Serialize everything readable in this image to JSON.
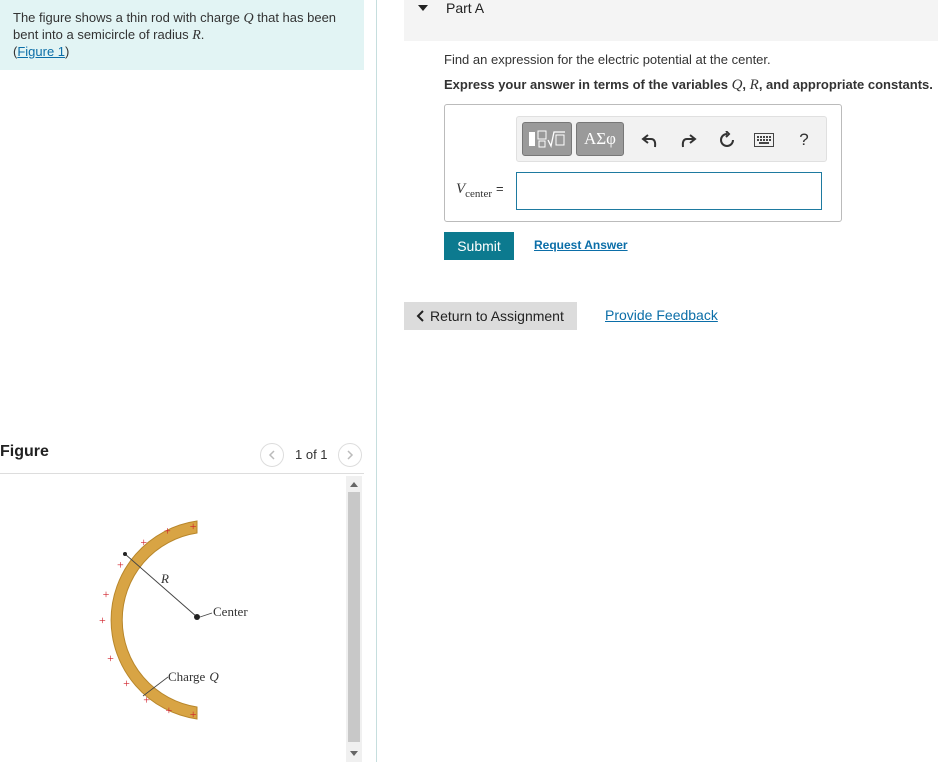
{
  "problem": {
    "text_before": "The figure shows a thin rod with charge ",
    "var_q": "Q",
    "text_middle": " that has been bent into a semicircle of radius ",
    "var_r": "R",
    "text_end": ".",
    "figure_link_open": "(",
    "figure_link": "Figure 1",
    "figure_link_close": ")"
  },
  "figure_panel": {
    "title": "Figure",
    "counter": "1 of 1",
    "labels": {
      "radius": "R",
      "center": "Center",
      "charge": "Charge",
      "charge_var": "Q",
      "plus": "+"
    },
    "colors": {
      "rod": "#d8a444",
      "rod_edge": "#b8862a",
      "plus": "#d0202a"
    }
  },
  "part": {
    "label": "Part A",
    "question": "Find an expression for the electric potential at the center.",
    "instruction_before": "Express your answer in terms of the variables ",
    "instruction_q": "Q",
    "instruction_sep": ", ",
    "instruction_r": "R",
    "instruction_after": ", and appropriate constants."
  },
  "answer": {
    "var_main": "V",
    "var_sub": "center",
    "equals": "=",
    "value": "",
    "toolbar": {
      "templates_icon": "templates-icon",
      "symbols_label": "ΑΣφ",
      "undo_icon": "undo-icon",
      "redo_icon": "redo-icon",
      "reset_icon": "reset-icon",
      "keyboard_icon": "keyboard-icon",
      "help_label": "?"
    }
  },
  "actions": {
    "submit": "Submit",
    "request_answer": "Request Answer",
    "return": "Return to Assignment",
    "feedback": "Provide Feedback"
  },
  "theme": {
    "intro_bg": "#e2f4f4",
    "link": "#0b6ea8",
    "submit_bg": "#0c7a8f",
    "input_border": "#1e7aa0"
  }
}
